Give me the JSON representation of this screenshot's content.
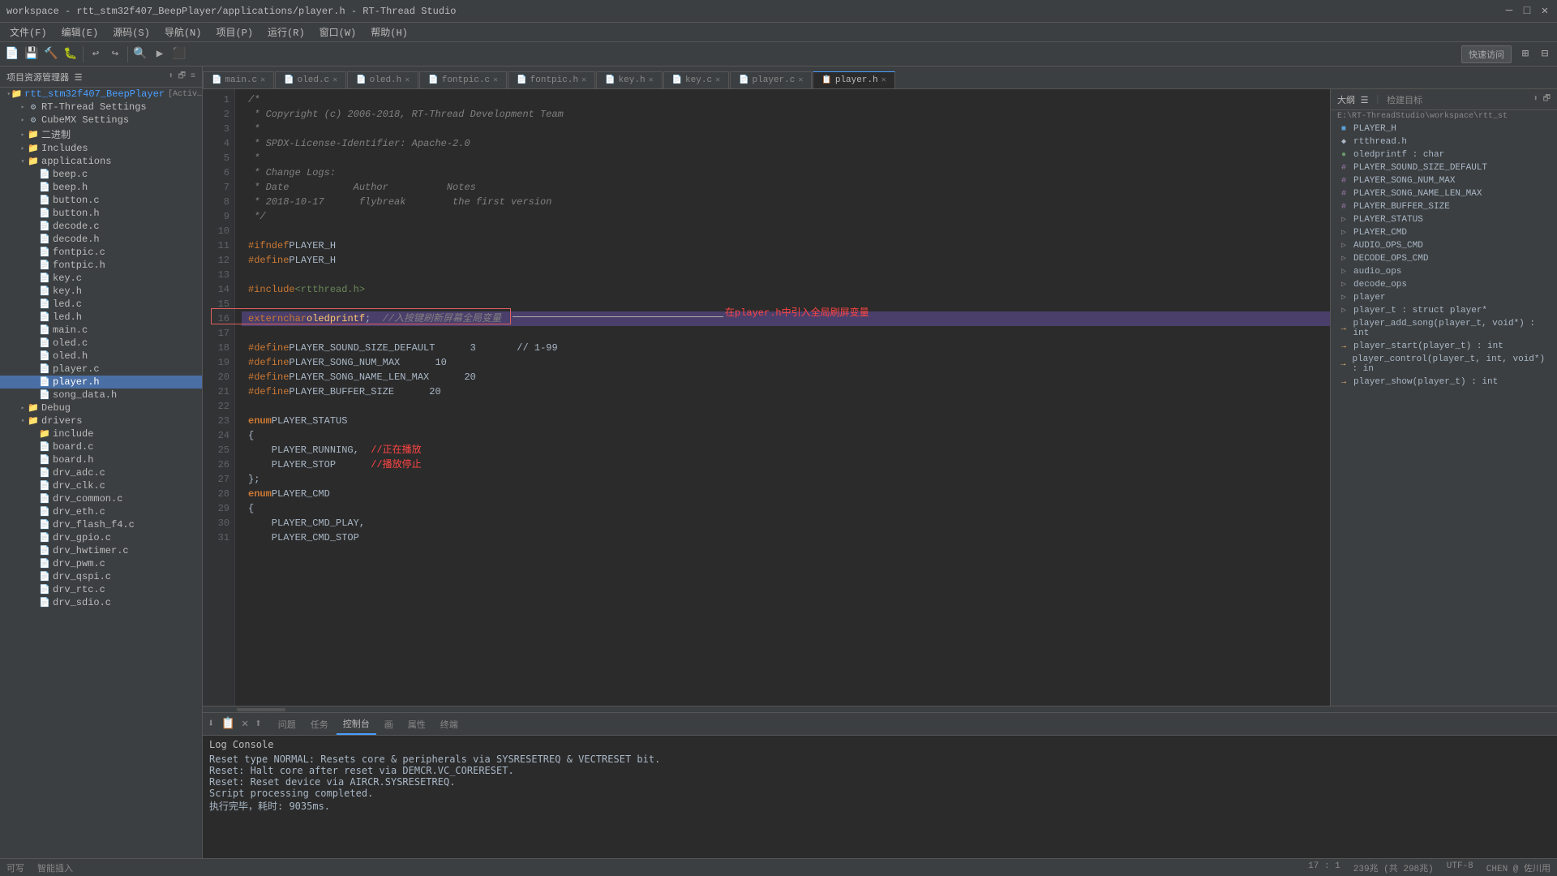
{
  "titleBar": {
    "title": "workspace - rtt_stm32f407_BeepPlayer/applications/player.h - RT-Thread Studio",
    "minimize": "─",
    "maximize": "□",
    "close": "✕"
  },
  "menuBar": {
    "items": [
      "文件(F)",
      "编辑(E)",
      "源码(S)",
      "导航(N)",
      "项目(P)",
      "运行(R)",
      "窗口(W)",
      "帮助(H)"
    ]
  },
  "quickAccess": "快速访问",
  "sidebar": {
    "header": "项目资源管理器 ☰",
    "tree": [
      {
        "label": "rtt_stm32f407_BeepPlayer",
        "level": 0,
        "expanded": true,
        "isRoot": true,
        "tag": "[Activ…"
      },
      {
        "label": "RT-Thread Settings",
        "level": 1,
        "expanded": false,
        "icon": "⚙"
      },
      {
        "label": "CubeMX Settings",
        "level": 1,
        "expanded": false,
        "icon": "⚙"
      },
      {
        "label": "二进制",
        "level": 1,
        "expanded": false,
        "icon": "📁"
      },
      {
        "label": "Includes",
        "level": 1,
        "expanded": false,
        "icon": "📁"
      },
      {
        "label": "applications",
        "level": 1,
        "expanded": true,
        "icon": "📁"
      },
      {
        "label": "beep.c",
        "level": 2,
        "icon": "📄"
      },
      {
        "label": "beep.h",
        "level": 2,
        "icon": "📄"
      },
      {
        "label": "button.c",
        "level": 2,
        "icon": "📄"
      },
      {
        "label": "button.h",
        "level": 2,
        "icon": "📄"
      },
      {
        "label": "decode.c",
        "level": 2,
        "icon": "📄"
      },
      {
        "label": "decode.h",
        "level": 2,
        "icon": "📄"
      },
      {
        "label": "fontpic.c",
        "level": 2,
        "icon": "📄"
      },
      {
        "label": "fontpic.h",
        "level": 2,
        "icon": "📄"
      },
      {
        "label": "key.c",
        "level": 2,
        "icon": "📄"
      },
      {
        "label": "key.h",
        "level": 2,
        "icon": "📄"
      },
      {
        "label": "led.c",
        "level": 2,
        "icon": "📄"
      },
      {
        "label": "led.h",
        "level": 2,
        "icon": "📄"
      },
      {
        "label": "main.c",
        "level": 2,
        "icon": "📄"
      },
      {
        "label": "oled.c",
        "level": 2,
        "icon": "📄"
      },
      {
        "label": "oled.h",
        "level": 2,
        "icon": "📄"
      },
      {
        "label": "player.c",
        "level": 2,
        "icon": "📄"
      },
      {
        "label": "player.h",
        "level": 2,
        "icon": "📄",
        "selected": true
      },
      {
        "label": "song_data.h",
        "level": 2,
        "icon": "📄"
      },
      {
        "label": "Debug",
        "level": 1,
        "expanded": false,
        "icon": "📁"
      },
      {
        "label": "drivers",
        "level": 1,
        "expanded": true,
        "icon": "📁"
      },
      {
        "label": "include",
        "level": 2,
        "icon": "📁"
      },
      {
        "label": "board.c",
        "level": 2,
        "icon": "📄"
      },
      {
        "label": "board.h",
        "level": 2,
        "icon": "📄"
      },
      {
        "label": "drv_adc.c",
        "level": 2,
        "icon": "📄"
      },
      {
        "label": "drv_clk.c",
        "level": 2,
        "icon": "📄"
      },
      {
        "label": "drv_common.c",
        "level": 2,
        "icon": "📄"
      },
      {
        "label": "drv_eth.c",
        "level": 2,
        "icon": "📄"
      },
      {
        "label": "drv_flash_f4.c",
        "level": 2,
        "icon": "📄"
      },
      {
        "label": "drv_gpio.c",
        "level": 2,
        "icon": "📄"
      },
      {
        "label": "drv_hwtimer.c",
        "level": 2,
        "icon": "📄"
      },
      {
        "label": "drv_pwm.c",
        "level": 2,
        "icon": "📄"
      },
      {
        "label": "drv_qspi.c",
        "level": 2,
        "icon": "📄"
      },
      {
        "label": "drv_rtc.c",
        "level": 2,
        "icon": "📄"
      },
      {
        "label": "drv_sdio.c",
        "level": 2,
        "icon": "📄"
      }
    ]
  },
  "tabs": [
    {
      "label": "main.c",
      "active": false,
      "closable": true
    },
    {
      "label": "oled.c",
      "active": false,
      "closable": true
    },
    {
      "label": "oled.h",
      "active": false,
      "closable": true
    },
    {
      "label": "fontpic.c",
      "active": false,
      "closable": true
    },
    {
      "label": "fontpic.h",
      "active": false,
      "closable": true
    },
    {
      "label": "key.h",
      "active": false,
      "closable": true
    },
    {
      "label": "key.c",
      "active": false,
      "closable": true
    },
    {
      "label": "player.c",
      "active": false,
      "closable": true
    },
    {
      "label": "player.h",
      "active": true,
      "closable": true
    }
  ],
  "codeLines": [
    {
      "num": 1,
      "content": "/*"
    },
    {
      "num": 2,
      "content": " * Copyright (c) 2006-2018, RT-Thread Development Team"
    },
    {
      "num": 3,
      "content": " *"
    },
    {
      "num": 4,
      "content": " * SPDX-License-Identifier: Apache-2.0"
    },
    {
      "num": 5,
      "content": " *"
    },
    {
      "num": 6,
      "content": " * Change Logs:"
    },
    {
      "num": 7,
      "content": " * Date           Author          Notes"
    },
    {
      "num": 8,
      "content": " * 2018-10-17      flybreak        the first version"
    },
    {
      "num": 9,
      "content": " */"
    },
    {
      "num": 10,
      "content": ""
    },
    {
      "num": 11,
      "content": "#ifndef PLAYER_H"
    },
    {
      "num": 12,
      "content": "#define PLAYER_H"
    },
    {
      "num": 13,
      "content": ""
    },
    {
      "num": 14,
      "content": "#include <rtthread.h>"
    },
    {
      "num": 15,
      "content": ""
    },
    {
      "num": 16,
      "content": "extern char oledprintf;  //入按键刷新屏幕全局变量",
      "highlight": true
    },
    {
      "num": 17,
      "content": ""
    },
    {
      "num": 18,
      "content": "#define PLAYER_SOUND_SIZE_DEFAULT      3       // 1-99"
    },
    {
      "num": 19,
      "content": "#define PLAYER_SONG_NUM_MAX      10"
    },
    {
      "num": 20,
      "content": "#define PLAYER_SONG_NAME_LEN_MAX      20"
    },
    {
      "num": 21,
      "content": "#define PLAYER_BUFFER_SIZE      20"
    },
    {
      "num": 22,
      "content": ""
    },
    {
      "num": 23,
      "content": "enum PLAYER_STATUS"
    },
    {
      "num": 24,
      "content": "{"
    },
    {
      "num": 25,
      "content": "    PLAYER_RUNNING,  //正在播放"
    },
    {
      "num": 26,
      "content": "    PLAYER_STOP      //播放停止"
    },
    {
      "num": 27,
      "content": "};"
    },
    {
      "num": 28,
      "content": "enum PLAYER_CMD"
    },
    {
      "num": 29,
      "content": "{"
    },
    {
      "num": 30,
      "content": "    PLAYER_CMD_PLAY,"
    },
    {
      "num": 31,
      "content": "    PLAYER_CMD_STOP"
    }
  ],
  "annotation": {
    "text": "在player.h中引入全局刷屏变量"
  },
  "outline": {
    "header": "大纲 ☰",
    "searchHeader": "检建目标",
    "path": "E:\\RT-ThreadStudio\\workspace\\rtt_st",
    "items": [
      {
        "icon": "■",
        "iconColor": "#5c9fd4",
        "label": "PLAYER_H",
        "type": "define"
      },
      {
        "icon": "◆",
        "iconColor": "#a9b7c6",
        "label": "rtthread.h",
        "type": "include"
      },
      {
        "icon": "●",
        "iconColor": "#6a9a6a",
        "label": "oledprintf : char",
        "type": "var"
      },
      {
        "icon": "#",
        "iconColor": "#9876aa",
        "label": "PLAYER_SOUND_SIZE_DEFAULT",
        "type": "hash"
      },
      {
        "icon": "#",
        "iconColor": "#9876aa",
        "label": "PLAYER_SONG_NUM_MAX",
        "type": "hash"
      },
      {
        "icon": "#",
        "iconColor": "#9876aa",
        "label": "PLAYER_SONG_NAME_LEN_MAX",
        "type": "hash"
      },
      {
        "icon": "#",
        "iconColor": "#9876aa",
        "label": "PLAYER_BUFFER_SIZE",
        "type": "hash"
      },
      {
        "icon": "▷",
        "iconColor": "#888",
        "label": "PLAYER_STATUS",
        "type": "enum"
      },
      {
        "icon": "▷",
        "iconColor": "#888",
        "label": "PLAYER_CMD",
        "type": "enum"
      },
      {
        "icon": "▷",
        "iconColor": "#888",
        "label": "AUDIO_OPS_CMD",
        "type": "enum"
      },
      {
        "icon": "▷",
        "iconColor": "#888",
        "label": "DECODE_OPS_CMD",
        "type": "enum"
      },
      {
        "icon": "▷",
        "iconColor": "#888",
        "label": "audio_ops",
        "type": "struct"
      },
      {
        "icon": "▷",
        "iconColor": "#888",
        "label": "decode_ops",
        "type": "struct"
      },
      {
        "icon": "▷",
        "iconColor": "#888",
        "label": "player",
        "type": "struct"
      },
      {
        "icon": "▷",
        "iconColor": "#888",
        "label": "player_t : struct player*",
        "type": "typedef"
      },
      {
        "icon": "→",
        "iconColor": "#ffc66d",
        "label": "player_add_song(player_t, void*) : int",
        "type": "func"
      },
      {
        "icon": "→",
        "iconColor": "#ffc66d",
        "label": "player_start(player_t) : int",
        "type": "func"
      },
      {
        "icon": "→",
        "iconColor": "#ffc66d",
        "label": "player_control(player_t, int, void*) : in",
        "type": "func"
      },
      {
        "icon": "→",
        "iconColor": "#ffc66d",
        "label": "player_show(player_t) : int",
        "type": "func"
      }
    ]
  },
  "bottomPanel": {
    "tabs": [
      "问题",
      "任务",
      "控制台",
      "画",
      "属性",
      "终端"
    ],
    "activeTab": "控制台",
    "logTitle": "Log Console",
    "logLines": [
      "Reset type NORMAL: Resets core & peripherals via SYSRESETREQ & VECTRESET bit.",
      "Reset: Halt core after reset via DEMCR.VC_CORERESET.",
      "Reset: Reset device via AIRCR.SYSRESETREQ.",
      "Script processing completed.",
      "执行完毕，耗时: 9035ms."
    ]
  },
  "statusBar": {
    "mode": "可写",
    "insertMode": "智能插入",
    "position": "17 : 1",
    "encoding": "239兆 (共 298兆)",
    "charset": "UTF-8",
    "user": "CHEN @ 佐川用"
  }
}
